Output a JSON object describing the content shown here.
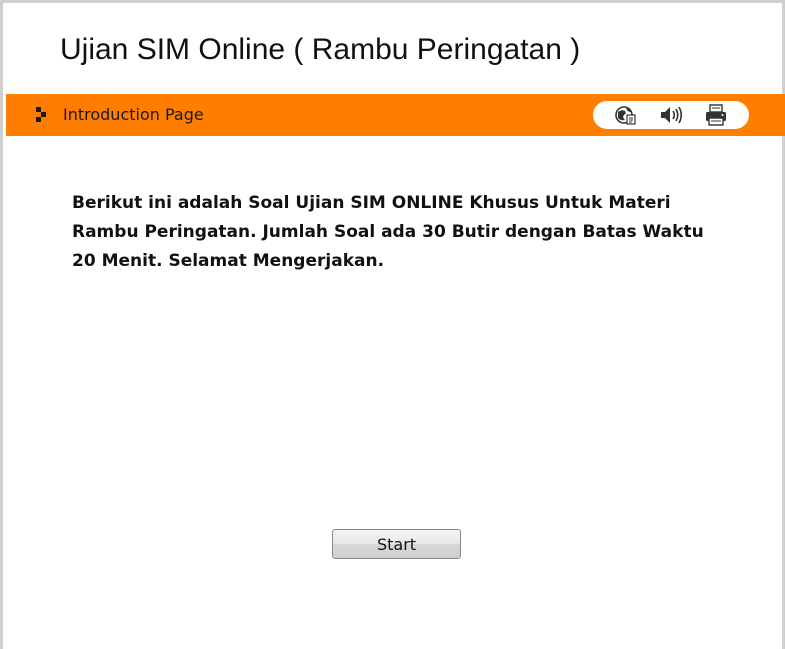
{
  "header": {
    "title": "Ujian SIM Online ( Rambu Peringatan )"
  },
  "nav_bar": {
    "label": "Introduction Page",
    "bar_color": "#ff7d00",
    "tools": [
      {
        "icon": "globe-document-icon"
      },
      {
        "icon": "speaker-icon"
      },
      {
        "icon": "printer-icon"
      }
    ]
  },
  "main": {
    "intro_text": "Berikut ini adalah Soal Ujian SIM ONLINE Khusus Untuk Materi Rambu Peringatan. Jumlah Soal ada 30 Butir dengan Batas Waktu 20 Menit. Selamat Mengerjakan.",
    "start_label": "Start"
  }
}
